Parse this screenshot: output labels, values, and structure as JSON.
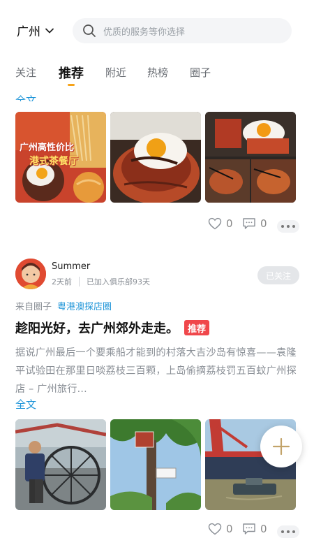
{
  "header": {
    "city": "广州",
    "search_placeholder": "优质的服务等你选择"
  },
  "tabs": [
    {
      "label": "关注"
    },
    {
      "label": "推荐",
      "active": true
    },
    {
      "label": "附近"
    },
    {
      "label": "热榜"
    },
    {
      "label": "圈子"
    }
  ],
  "post1": {
    "cut_text": "全文",
    "photo1_caption_line1": "广州高性价比",
    "photo1_caption_line2": "港式茶餐厅",
    "likes": "0",
    "comments": "0"
  },
  "post2": {
    "username": "Summer",
    "time": "2天前",
    "club": "已加入俱乐部93天",
    "follow_label": "已关注",
    "from_label": "来自圈子",
    "circle_name": "粤港澳探店圈",
    "title": "趁阳光好，去广州郊外走走。",
    "badge": "推荐",
    "body": "据说广州最后一个要乘船才能到的村落大吉沙岛有惊喜——袁隆平试验田在那里日啖荔枝三百颗，上岛偷摘荔枝罚五百蚊广州探店 – 广州旅行...",
    "fulltext_label": "全文",
    "likes": "0",
    "comments": "0"
  },
  "colors": {
    "accent_blue": "#1d94d8",
    "tab_indicator": "#f6a31a",
    "badge_red": "#f0474b"
  },
  "icons": [
    "chevron-down-icon",
    "search-icon",
    "heart-icon",
    "comment-icon",
    "more-icon",
    "plus-icon"
  ]
}
